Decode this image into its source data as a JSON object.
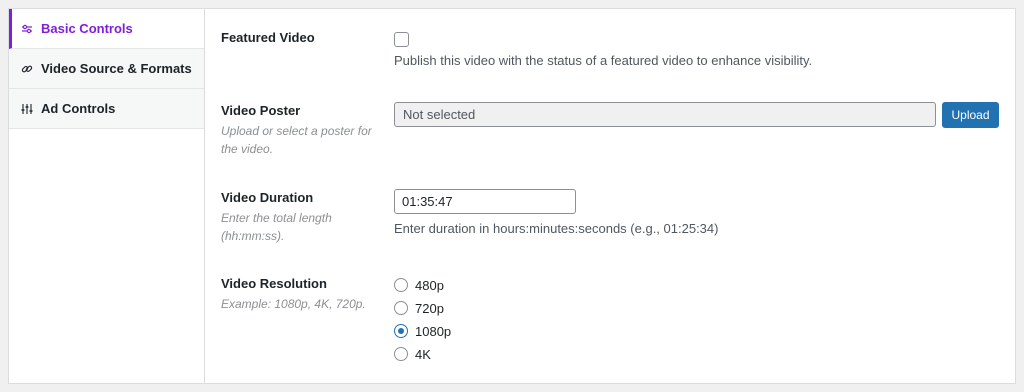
{
  "tabs": [
    {
      "label": "Basic Controls",
      "icon": "sliders-icon",
      "active": true
    },
    {
      "label": "Video Source & Formats",
      "icon": "link-icon",
      "active": false
    },
    {
      "label": "Ad Controls",
      "icon": "equalizer-icon",
      "active": false
    }
  ],
  "featured": {
    "label": "Featured Video",
    "checked": false,
    "help": "Publish this video with the status of a featured video to enhance visibility."
  },
  "poster": {
    "label": "Video Poster",
    "description": "Upload or select a poster for the video.",
    "value": "Not selected",
    "button_label": "Upload"
  },
  "duration": {
    "label": "Video Duration",
    "description": "Enter the total length (hh:mm:ss).",
    "value": "01:35:47",
    "help": "Enter duration in hours:minutes:seconds (e.g., 01:25:34)"
  },
  "resolution": {
    "label": "Video Resolution",
    "description": "Example: 1080p, 4K, 720p.",
    "options": [
      "480p",
      "720p",
      "1080p",
      "4K"
    ],
    "selected": "1080p"
  },
  "colors": {
    "accent": "#7e1fd9",
    "primary_button": "#2271b1"
  }
}
